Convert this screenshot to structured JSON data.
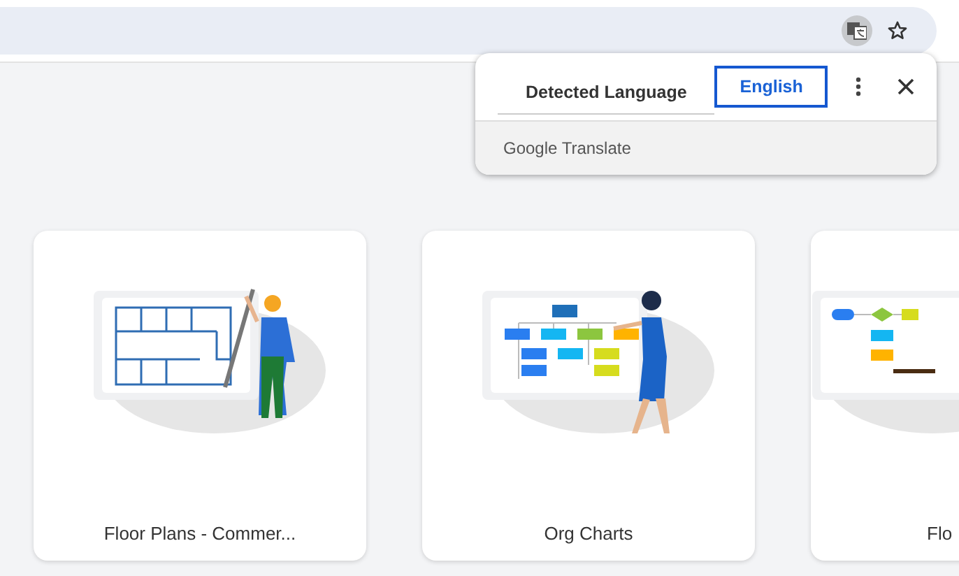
{
  "translate_popup": {
    "tabs": [
      {
        "label": "Detected Language",
        "selected": false
      },
      {
        "label": "English",
        "selected": true
      }
    ],
    "footer": "Google Translate"
  },
  "cards": [
    {
      "kind": "floor-plan",
      "label": "Floor Plans - Commer..."
    },
    {
      "kind": "org-chart",
      "label": "Org Charts"
    },
    {
      "kind": "flowchart",
      "label": "Flo"
    }
  ]
}
